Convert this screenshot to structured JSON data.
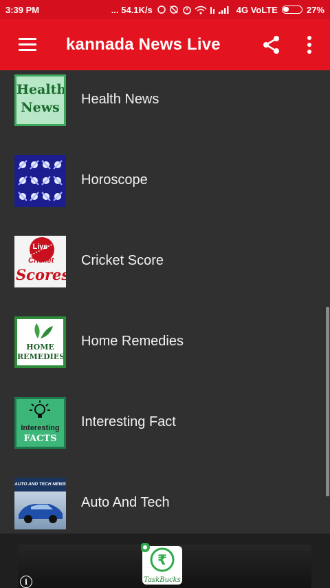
{
  "status_bar": {
    "time": "3:39 PM",
    "indicators": "... 54.1K/s",
    "network": "4G VoLTE",
    "battery": "27%"
  },
  "app_bar": {
    "title": "kannada News Live",
    "menu_icon": "hamburger-menu-icon",
    "share_icon": "share-icon",
    "more_icon": "more-vert-icon"
  },
  "list": {
    "items": [
      {
        "label": "Health News",
        "thumb_text": [
          "Health",
          "News"
        ]
      },
      {
        "label": "Horoscope",
        "thumb_text": []
      },
      {
        "label": "Cricket Score",
        "thumb_text": [
          "Live",
          "Cricket",
          "Scores"
        ]
      },
      {
        "label": "Home Remedies",
        "thumb_text": [
          "HOME",
          "REMEDIES"
        ]
      },
      {
        "label": "Interesting Fact",
        "thumb_text": [
          "Interesting",
          "FACTS"
        ]
      },
      {
        "label": "Auto And Tech",
        "thumb_text": [
          "AUTO AND TECH NEWS"
        ]
      }
    ]
  },
  "ad": {
    "info_label": "i",
    "brand": "TaskBucks"
  },
  "colors": {
    "status_bar": "#d50f1e",
    "app_bar": "#e3141f",
    "background": "#303030"
  }
}
